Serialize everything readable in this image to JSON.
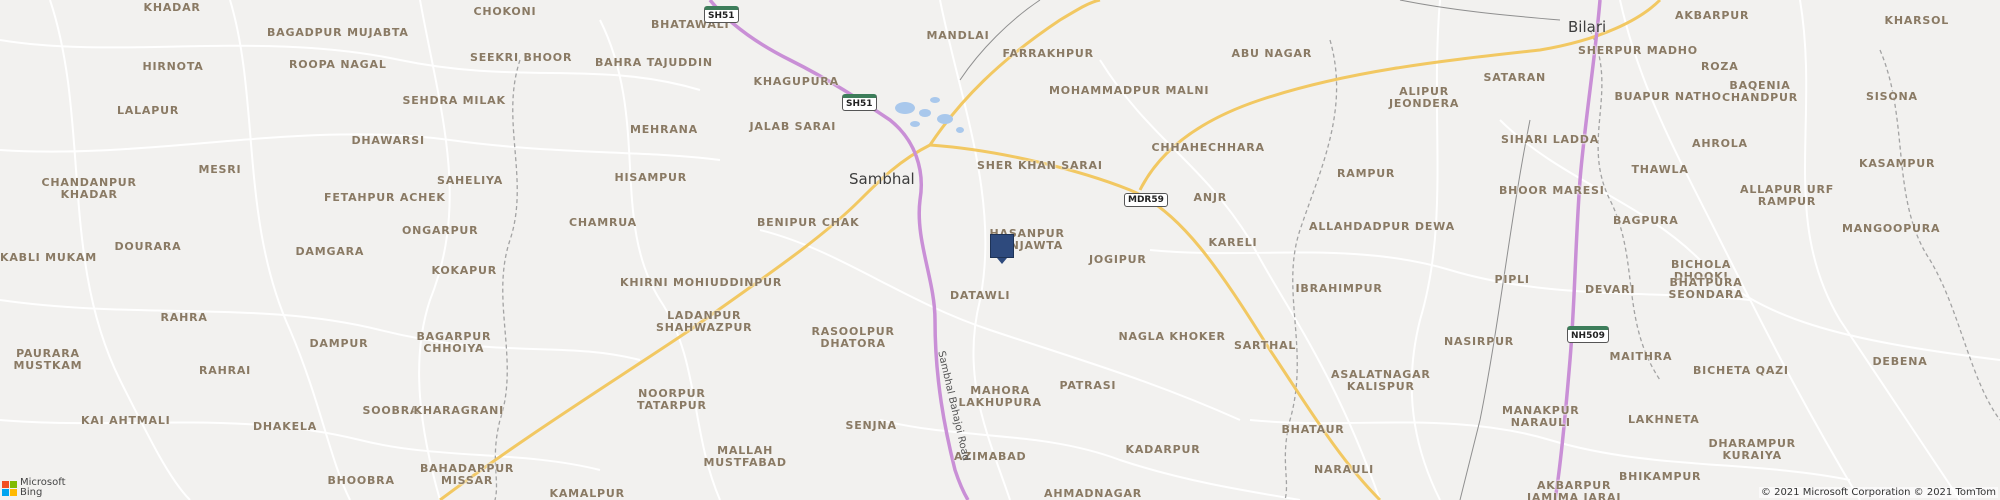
{
  "colors": {
    "background": "#f2f1ef",
    "highway": "#c98fd6",
    "major_road": "#f5d27a",
    "minor_road": "#ffffff",
    "boundary": "#9a9a9a",
    "water": "#a9c8ec",
    "label": "#8a7a64",
    "pin": "#2e4a7d"
  },
  "cities": [
    {
      "id": "sambhal",
      "name": "Sambhal"
    },
    {
      "id": "bilari",
      "name": "Bilari"
    }
  ],
  "villages": [
    {
      "name": "KHADAR"
    },
    {
      "name": "BAGADPUR MUJABTA"
    },
    {
      "name": "CHOKONI"
    },
    {
      "name": "BHATAWALI"
    },
    {
      "name": "MANDLAI"
    },
    {
      "name": "FARRAKHPUR"
    },
    {
      "name": "HIRNOTA"
    },
    {
      "name": "ROOPA NAGAL"
    },
    {
      "name": "SEEKRI BHOOR"
    },
    {
      "name": "BAHRA TAJUDDIN"
    },
    {
      "name": "KHAGUPURA"
    },
    {
      "name": "LALAPUR"
    },
    {
      "name": "SEHDRA MILAK"
    },
    {
      "name": "JALAB SARAI"
    },
    {
      "name": "MOHAMMADPUR MALNI"
    },
    {
      "name": "ABU NAGAR"
    },
    {
      "name": "DHAWARSI"
    },
    {
      "name": "MEHRANA"
    },
    {
      "name": "SHER KHAN SARAI"
    },
    {
      "name": "CHHAHECHHARA"
    },
    {
      "name": "MESRI"
    },
    {
      "name": "HISAMPUR"
    },
    {
      "name": "CHANDANPUR KHADAR"
    },
    {
      "name": "SAHELIYA"
    },
    {
      "name": "FETAHPUR ACHEK"
    },
    {
      "name": "ANJR"
    },
    {
      "name": "RAMPUR"
    },
    {
      "name": "CHAMRUA"
    },
    {
      "name": "BENIPUR CHAK"
    },
    {
      "name": "ONGARPUR"
    },
    {
      "name": "HASANPUR BANJAWTA"
    },
    {
      "name": "JOGIPUR"
    },
    {
      "name": "KARELI"
    },
    {
      "name": "ALLAHDADPUR DEWA"
    },
    {
      "name": "DOURARA"
    },
    {
      "name": "DAMGARA"
    },
    {
      "name": "KABLI MUKAM"
    },
    {
      "name": "KOKAPUR"
    },
    {
      "name": "KHIRNI MOHIUDDINPUR"
    },
    {
      "name": "DATAWLI"
    },
    {
      "name": "IBRAHIMPUR"
    },
    {
      "name": "RAHRA"
    },
    {
      "name": "LADANPUR SHAHWAZPUR"
    },
    {
      "name": "RASOOLPUR DHATORA"
    },
    {
      "name": "NAGLA KHOKER"
    },
    {
      "name": "SARTHAL"
    },
    {
      "name": "PAURARA MUSTKAM"
    },
    {
      "name": "BAGARPUR CHHOIYA"
    },
    {
      "name": "DAMPUR"
    },
    {
      "name": "RAHRAI"
    },
    {
      "name": "PATRASI"
    },
    {
      "name": "ASALATNAGAR KALISPUR"
    },
    {
      "name": "NOORPUR TATARPUR"
    },
    {
      "name": "MAHORA LAKHUPURA"
    },
    {
      "name": "KAI AHTMALI"
    },
    {
      "name": "DHAKELA"
    },
    {
      "name": "SOOBRA"
    },
    {
      "name": "KHARAGRANI"
    },
    {
      "name": "SENJNA"
    },
    {
      "name": "BHATAUR"
    },
    {
      "name": "KADARPUR"
    },
    {
      "name": "MALLAH MUSTFABAD"
    },
    {
      "name": "AZIMABAD"
    },
    {
      "name": "BHOOBRA"
    },
    {
      "name": "BAHADARPUR MISSAR"
    },
    {
      "name": "NARAULI"
    },
    {
      "name": "KAMALPUR"
    },
    {
      "name": "AHMADNAGAR"
    },
    {
      "name": "ALIPUR JEONDERA"
    },
    {
      "name": "SATARAN"
    },
    {
      "name": "SHERPUR MADHO"
    },
    {
      "name": "SIHARI LADDA"
    },
    {
      "name": "BHOOR MARESI"
    },
    {
      "name": "PIPLI"
    },
    {
      "name": "NASIRPUR"
    },
    {
      "name": "MANAKPUR NARAULI"
    },
    {
      "name": "AKBARPUR JAMIMA JARAI"
    },
    {
      "name": "ROZA"
    },
    {
      "name": "AKBARPUR"
    },
    {
      "name": "KHARSOL"
    },
    {
      "name": "BUAPUR NATHO"
    },
    {
      "name": "BAQENIA CHANDPUR"
    },
    {
      "name": "SISONA"
    },
    {
      "name": "AHROLA"
    },
    {
      "name": "THAWLA"
    },
    {
      "name": "KASAMPUR"
    },
    {
      "name": "ALLAPUR URF RAMPUR"
    },
    {
      "name": "BAGPURA"
    },
    {
      "name": "MANGOOPURA"
    },
    {
      "name": "BICHOLA DHOOKI"
    },
    {
      "name": "DEVARI"
    },
    {
      "name": "BHATPURA SEONDARA"
    },
    {
      "name": "MAITHRA"
    },
    {
      "name": "DEBENA"
    },
    {
      "name": "BICHETA QAZI"
    },
    {
      "name": "LAKHNETA"
    },
    {
      "name": "DHARAMPUR KURAIYA"
    },
    {
      "name": "BHIKAMPUR"
    }
  ],
  "shields": [
    {
      "label": "SH51",
      "style": "green"
    },
    {
      "label": "SH51",
      "style": "green"
    },
    {
      "label": "MDR59",
      "style": "plain"
    },
    {
      "label": "NH509",
      "style": "green"
    }
  ],
  "road_names": [
    {
      "name": "Sambhal Bahajoi Road"
    }
  ],
  "attribution": {
    "logo_line1": "Microsoft",
    "logo_line2": "Bing",
    "copyright": "© 2021 Microsoft Corporation © 2021 TomTom"
  }
}
